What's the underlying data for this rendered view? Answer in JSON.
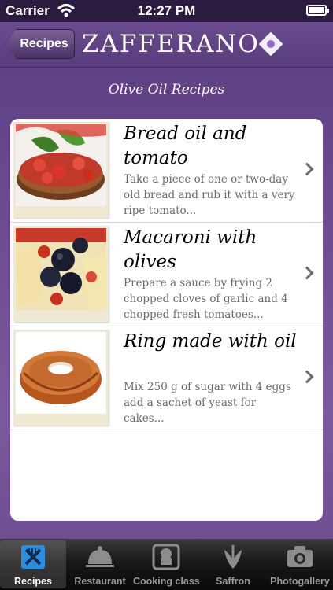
{
  "status_bar": {
    "carrier": "Carrier",
    "time": "12:27 PM"
  },
  "nav": {
    "back_label": "Recipes",
    "title": "ZAFFERANO"
  },
  "section_title": "Olive Oil Recipes",
  "recipes": [
    {
      "title": "Bread oil and tomato",
      "description": "Take a piece of one or two-day old bread and rub it with a very ripe tomato...",
      "image": "bruschetta"
    },
    {
      "title": "Macaroni with olives",
      "description": "Prepare a sauce by frying 2 chopped cloves of garlic and 4 chopped fresh tomatoes...",
      "image": "macaroni"
    },
    {
      "title": "Ring made with oil",
      "description": "Mix 250 g of sugar with 4 eggs add a sachet of yeast for cakes...",
      "image": "ring-cake"
    }
  ],
  "tabs": [
    {
      "label": "Recipes",
      "icon": "recipes-icon",
      "active": true
    },
    {
      "label": "Restaurant",
      "icon": "cloche-icon",
      "active": false
    },
    {
      "label": "Cooking class",
      "icon": "chef-icon",
      "active": false
    },
    {
      "label": "Saffron",
      "icon": "saffron-icon",
      "active": false
    },
    {
      "label": "Photogallery",
      "icon": "camera-icon",
      "active": false
    }
  ],
  "colors": {
    "accent": "#6d4c92",
    "active_tab": "#2b8de0"
  }
}
